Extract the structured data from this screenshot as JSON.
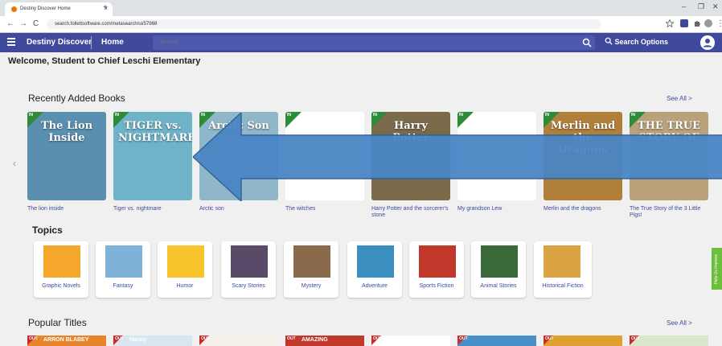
{
  "browser": {
    "tab_title": "Destiny Discover Home",
    "url": "search.follettsoftware.com/metasearch/ui/57968",
    "tab_close": "×",
    "new_tab": "+",
    "minimize": "–",
    "restore": "❐",
    "close": "✕",
    "back": "←",
    "forward": "→",
    "reload": "C"
  },
  "header": {
    "brand": "Destiny Discover",
    "home": "Home",
    "search_placeholder": "Search",
    "search_options": "Search Options"
  },
  "welcome": "Welcome, Student to Chief Leschi Elementary",
  "recent": {
    "title": "Recently Added Books",
    "see_all": "See All >",
    "badge": "IN",
    "books": [
      {
        "title": "The lion inside",
        "cover_text": "The Lion Inside",
        "color": "#5b8fb0"
      },
      {
        "title": "Tiger vs. nightmare",
        "cover_text": "TIGER vs. NIGHTMARE",
        "color": "#6fb3c8"
      },
      {
        "title": "Arctic son",
        "cover_text": "Arctic Son",
        "color": "#8fb7c9"
      },
      {
        "title": "The witches",
        "cover_text": "",
        "color": "#ffffff"
      },
      {
        "title": "Harry Potter and the sorcerer's stone",
        "cover_text": "Harry Potter",
        "color": "#7a6a4a"
      },
      {
        "title": "My grandson Lew",
        "cover_text": "",
        "color": "#ffffff"
      },
      {
        "title": "Merlin and the dragons",
        "cover_text": "Merlin and the Dragons",
        "color": "#b07f3a"
      },
      {
        "title": "The True Story of the 3 Little Pigs!",
        "cover_text": "THE TRUE STORY OF",
        "color": "#b9a27a"
      }
    ]
  },
  "topics": {
    "title": "Topics",
    "items": [
      {
        "label": "Graphic Novels",
        "color": "#f4a72b"
      },
      {
        "label": "Fantasy",
        "color": "#7fb2d9"
      },
      {
        "label": "Humor",
        "color": "#f7c52b"
      },
      {
        "label": "Scary Stories",
        "color": "#5a4a6a"
      },
      {
        "label": "Mystery",
        "color": "#8a6a4a"
      },
      {
        "label": "Adventure",
        "color": "#3b8fbf"
      },
      {
        "label": "Sports Fiction",
        "color": "#c0392b"
      },
      {
        "label": "Animal Stories",
        "color": "#3a6a3a"
      },
      {
        "label": "Historical Fiction",
        "color": "#d9a441"
      }
    ]
  },
  "popular": {
    "title": "Popular Titles",
    "see_all": "See All >",
    "badge": "OUT",
    "covers": [
      {
        "text": "ARRON BLABEY",
        "color": "#e8842a"
      },
      {
        "text": "Nancy",
        "color": "#d9e6f2"
      },
      {
        "text": "",
        "color": "#f5f0e8"
      },
      {
        "text": "AMAZING",
        "color": "#c0392b"
      },
      {
        "text": "",
        "color": "#ffffff"
      },
      {
        "text": "",
        "color": "#4a90c8"
      },
      {
        "text": "",
        "color": "#e0a030"
      },
      {
        "text": "",
        "color": "#d9e6cc"
      }
    ]
  },
  "feedback": "Help Us Improve",
  "colors": {
    "header": "#3f4a9c",
    "accent": "#3f4a9c",
    "in_badge": "#2e8b3a",
    "out_badge": "#c72b2b",
    "callout_arrow": "#4a86c5"
  }
}
